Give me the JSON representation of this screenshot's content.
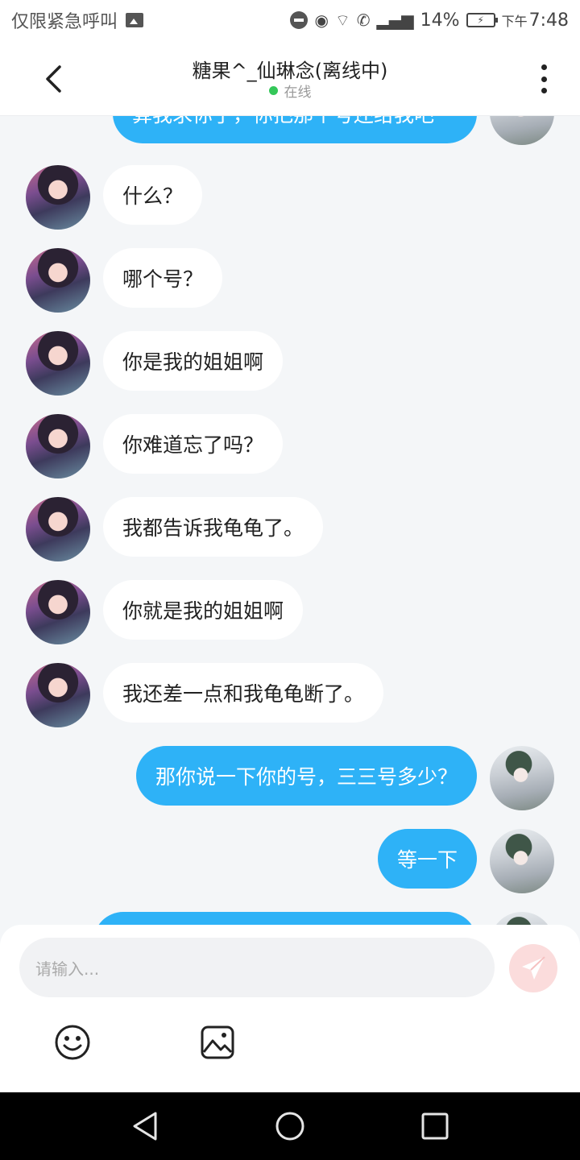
{
  "status_bar": {
    "carrier": "仅限紧急呼叫",
    "battery": "14%",
    "ampm": "下午",
    "time": "7:48"
  },
  "header": {
    "title": "糖果^_仙琳念(离线中)",
    "status": "在线"
  },
  "messages": [
    {
      "side": "self",
      "text": "算我求你了，你把那个号还给我吧"
    },
    {
      "side": "other",
      "text": "什么？"
    },
    {
      "side": "other",
      "text": "哪个号？"
    },
    {
      "side": "other",
      "text": "你是我的姐姐啊"
    },
    {
      "side": "other",
      "text": "你难道忘了吗？"
    },
    {
      "side": "other",
      "text": "我都告诉我龟龟了。"
    },
    {
      "side": "other",
      "text": "你就是我的姐姐啊"
    },
    {
      "side": "other",
      "text": "我还差一点和我龟龟断了。"
    },
    {
      "side": "self",
      "text": "那你说一下你的号，三三号多少？"
    },
    {
      "side": "self",
      "text": "等一下"
    },
    {
      "side": "self",
      "text": ""
    }
  ],
  "input": {
    "placeholder": "请输入..."
  },
  "icons": {
    "back": "chevron-left-icon",
    "more": "more-vertical-icon",
    "send": "paper-plane-icon",
    "emoji": "smiley-icon",
    "image": "image-icon"
  },
  "colors": {
    "self_bubble": "#2eb2f7",
    "other_bubble": "#ffffff",
    "online_dot": "#34c759",
    "send_button": "#fbdcdc"
  }
}
